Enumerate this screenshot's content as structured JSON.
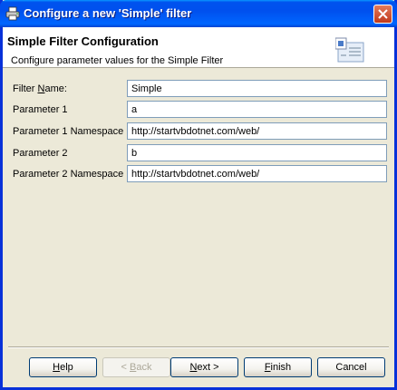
{
  "window": {
    "title": "Configure a new 'Simple' filter",
    "icon": "printer-icon",
    "close_icon": "close-icon"
  },
  "banner": {
    "title": "Simple Filter Configuration",
    "subtitle": "Configure parameter values for the Simple Filter",
    "icon": "config-card-icon"
  },
  "form": {
    "fields": [
      {
        "label_pre": "Filter ",
        "label_ul": "N",
        "label_post": "ame:",
        "value": "Simple"
      },
      {
        "label": "Parameter 1",
        "value": "a"
      },
      {
        "label": "Parameter 1 Namespace",
        "value": "http://startvbdotnet.com/web/"
      },
      {
        "label": "Parameter 2",
        "value": "b"
      },
      {
        "label": "Parameter 2 Namespace",
        "value": "http://startvbdotnet.com/web/"
      }
    ]
  },
  "buttons": {
    "help": {
      "ul": "H",
      "rest": "elp"
    },
    "back": {
      "pre": "< ",
      "ul": "B",
      "rest": "ack"
    },
    "next": {
      "ul": "N",
      "rest": "ext >"
    },
    "finish": {
      "ul": "F",
      "rest": "inish"
    },
    "cancel": {
      "label": "Cancel"
    }
  },
  "colors": {
    "titlebar": "#0054e3",
    "window_bg": "#ece9d8",
    "input_border": "#7f9db9"
  }
}
